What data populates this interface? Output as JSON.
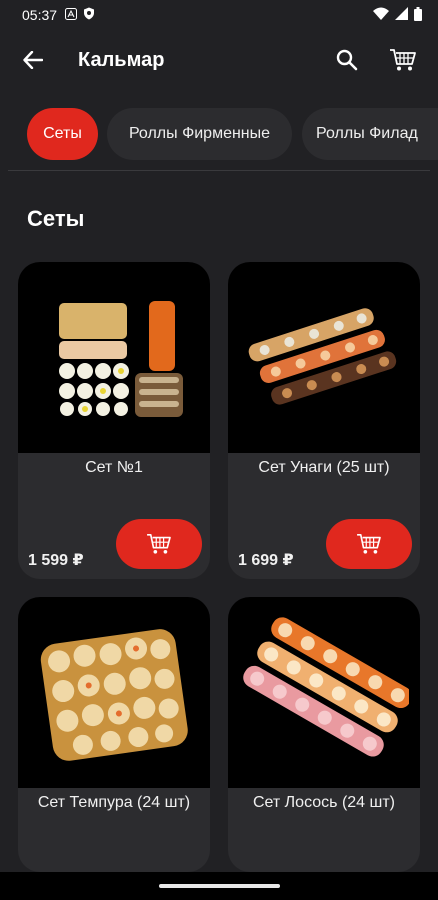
{
  "status": {
    "time": "05:37"
  },
  "header": {
    "title": "Кальмар"
  },
  "categories": [
    {
      "label": "Сеты",
      "active": true
    },
    {
      "label": "Роллы Фирменные",
      "active": false
    },
    {
      "label": "Роллы Филад",
      "active": false
    }
  ],
  "section": {
    "title": "Сеты"
  },
  "products": [
    {
      "name": "Сет №1",
      "price": "1 599 ₽"
    },
    {
      "name": "Сет Унаги (25 шт)",
      "price": "1 699 ₽"
    },
    {
      "name": "Сет Темпура (24 шт)",
      "price": ""
    },
    {
      "name": "Сет Лосось (24 шт)",
      "price": ""
    }
  ],
  "colors": {
    "accent": "#e0281e",
    "background": "#212124",
    "card": "#2c2c2f"
  },
  "icons": {
    "back": "arrow-left-icon",
    "search": "search-icon",
    "cart": "cart-icon"
  }
}
